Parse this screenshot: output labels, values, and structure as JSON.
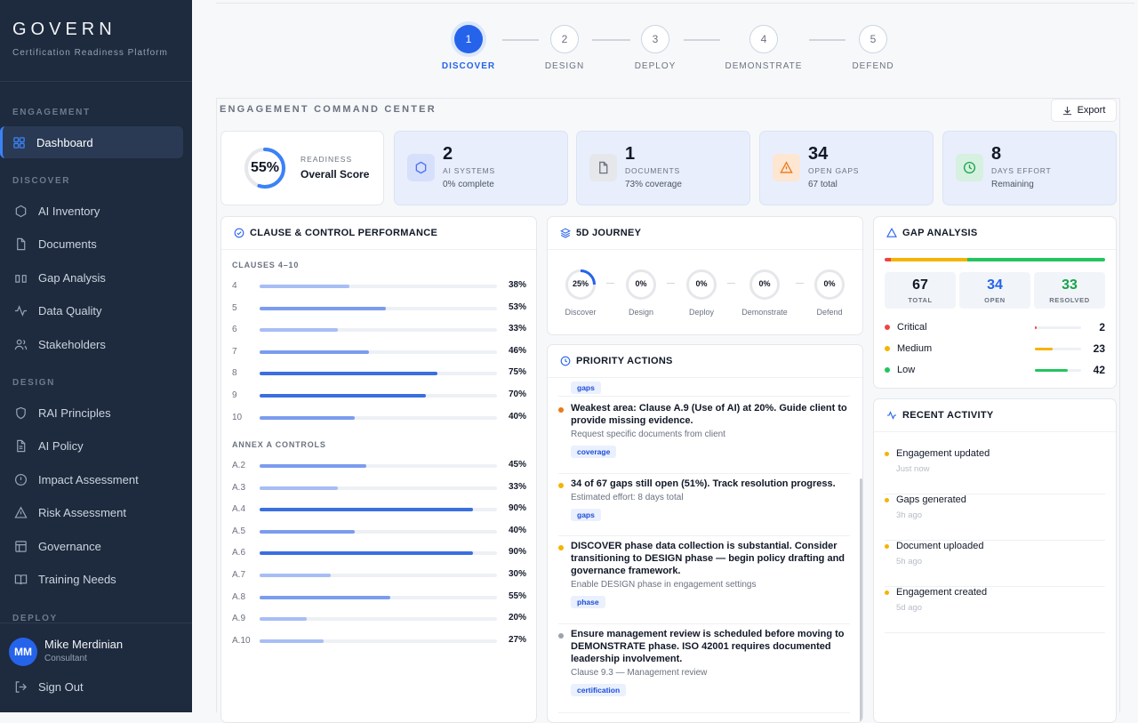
{
  "brand": {
    "title": "GOVERN",
    "subtitle": "Certification Readiness Platform"
  },
  "sidebar": {
    "sections": [
      {
        "label": "ENGAGEMENT"
      },
      {
        "label": "DISCOVER"
      },
      {
        "label": "DESIGN"
      },
      {
        "label": "DEPLOY"
      }
    ],
    "items": [
      {
        "label": "Dashboard",
        "icon": "grid-icon",
        "active": true
      },
      {
        "label": "AI Inventory",
        "icon": "hexagon-icon"
      },
      {
        "label": "Documents",
        "icon": "document-icon"
      },
      {
        "label": "Gap Analysis",
        "icon": "columns-icon"
      },
      {
        "label": "Data Quality",
        "icon": "activity-icon"
      },
      {
        "label": "Stakeholders",
        "icon": "users-icon"
      },
      {
        "label": "RAI Principles",
        "icon": "shield-icon"
      },
      {
        "label": "AI Policy",
        "icon": "file-text-icon"
      },
      {
        "label": "Impact Assessment",
        "icon": "alert-circle-icon"
      },
      {
        "label": "Risk Assessment",
        "icon": "warning-icon"
      },
      {
        "label": "Governance",
        "icon": "layout-icon"
      },
      {
        "label": "Training Needs",
        "icon": "book-icon"
      }
    ],
    "user": {
      "initials": "MM",
      "name": "Mike Merdinian",
      "role": "Consultant"
    },
    "signout": "Sign Out"
  },
  "stepper": [
    {
      "num": "1",
      "label": "DISCOVER",
      "active": true
    },
    {
      "num": "2",
      "label": "DESIGN"
    },
    {
      "num": "3",
      "label": "DEPLOY"
    },
    {
      "num": "4",
      "label": "DEMONSTRATE"
    },
    {
      "num": "5",
      "label": "DEFEND"
    }
  ],
  "command_center": {
    "title": "ENGAGEMENT COMMAND CENTER",
    "export_label": "Export"
  },
  "readiness": {
    "value": "55%",
    "percent": 55,
    "label": "READINESS",
    "sub": "Overall Score"
  },
  "kpis": [
    {
      "value": "2",
      "label": "AI SYSTEMS",
      "sub": "0% complete",
      "icon": "hexagon-icon",
      "color": "#4f6ef7",
      "bg": "#d6e0fb"
    },
    {
      "value": "1",
      "label": "DOCUMENTS",
      "sub": "73% coverage",
      "icon": "document-icon",
      "color": "#6b7280",
      "bg": "#e5e7eb"
    },
    {
      "value": "34",
      "label": "OPEN GAPS",
      "sub": "67 total",
      "icon": "warning-icon",
      "color": "#ea7a1a",
      "bg": "#fde6d2"
    },
    {
      "value": "8",
      "label": "DAYS EFFORT",
      "sub": "Remaining",
      "icon": "clock-icon",
      "color": "#16a34a",
      "bg": "#d6f1df"
    }
  ],
  "clauses": {
    "title": "CLAUSE & CONTROL PERFORMANCE",
    "clauses_label": "CLAUSES 4–10",
    "annex_label": "ANNEX A CONTROLS",
    "clause_rows": [
      {
        "label": "4",
        "pct": 38,
        "text": "38%"
      },
      {
        "label": "5",
        "pct": 53,
        "text": "53%"
      },
      {
        "label": "6",
        "pct": 33,
        "text": "33%"
      },
      {
        "label": "7",
        "pct": 46,
        "text": "46%"
      },
      {
        "label": "8",
        "pct": 75,
        "text": "75%"
      },
      {
        "label": "9",
        "pct": 70,
        "text": "70%"
      },
      {
        "label": "10",
        "pct": 40,
        "text": "40%"
      }
    ],
    "annex_rows": [
      {
        "label": "A.2",
        "pct": 45,
        "text": "45%"
      },
      {
        "label": "A.3",
        "pct": 33,
        "text": "33%"
      },
      {
        "label": "A.4",
        "pct": 90,
        "text": "90%"
      },
      {
        "label": "A.5",
        "pct": 40,
        "text": "40%"
      },
      {
        "label": "A.6",
        "pct": 90,
        "text": "90%"
      },
      {
        "label": "A.7",
        "pct": 30,
        "text": "30%"
      },
      {
        "label": "A.8",
        "pct": 55,
        "text": "55%"
      },
      {
        "label": "A.9",
        "pct": 20,
        "text": "20%"
      },
      {
        "label": "A.10",
        "pct": 27,
        "text": "27%"
      }
    ]
  },
  "journey": {
    "title": "5D JOURNEY",
    "phases": [
      {
        "pct": 25,
        "text": "25%",
        "label": "Discover"
      },
      {
        "pct": 0,
        "text": "0%",
        "label": "Design"
      },
      {
        "pct": 0,
        "text": "0%",
        "label": "Deploy"
      },
      {
        "pct": 0,
        "text": "0%",
        "label": "Demonstrate"
      },
      {
        "pct": 0,
        "text": "0%",
        "label": "Defend"
      }
    ]
  },
  "priority": {
    "title": "PRIORITY ACTIONS",
    "clipped_tag": "gaps",
    "items": [
      {
        "text": "Weakest area: Clause A.9 (Use of AI) at 20%. Guide client to provide missing evidence.",
        "sub": "Request specific documents from client",
        "tag": "coverage",
        "dot": "#ea7a1a"
      },
      {
        "text": "34 of 67 gaps still open (51%). Track resolution progress.",
        "sub": "Estimated effort: 8 days total",
        "tag": "gaps",
        "dot": "#f5b400"
      },
      {
        "text": "DISCOVER phase data collection is substantial. Consider transitioning to DESIGN phase — begin policy drafting and governance framework.",
        "sub": "Enable DESIGN phase in engagement settings",
        "tag": "phase",
        "dot": "#f5b400"
      },
      {
        "text": "Ensure management review is scheduled before moving to DEMONSTRATE phase. ISO 42001 requires documented leadership involvement.",
        "sub": "Clause 9.3 — Management review",
        "tag": "certification",
        "dot": "#9ca3af"
      }
    ]
  },
  "gap": {
    "title": "GAP ANALYSIS",
    "boxes": [
      {
        "num": "67",
        "label": "TOTAL",
        "color": "#111827"
      },
      {
        "num": "34",
        "label": "OPEN",
        "color": "#2563eb"
      },
      {
        "num": "33",
        "label": "RESOLVED",
        "color": "#16a34a"
      }
    ],
    "split": {
      "critical": 2,
      "medium": 23,
      "low": 42
    },
    "rows": [
      {
        "label": "Critical",
        "count": "2",
        "value": 2,
        "color": "#ef4444"
      },
      {
        "label": "Medium",
        "count": "23",
        "value": 23,
        "color": "#f5b400"
      },
      {
        "label": "Low",
        "count": "42",
        "value": 42,
        "color": "#22c55e"
      }
    ]
  },
  "activity": {
    "title": "RECENT ACTIVITY",
    "items": [
      {
        "title": "Engagement updated",
        "time": "Just now"
      },
      {
        "title": "Gaps generated",
        "time": "3h ago"
      },
      {
        "title": "Document uploaded",
        "time": "5h ago"
      },
      {
        "title": "Engagement created",
        "time": "5d ago"
      }
    ]
  }
}
